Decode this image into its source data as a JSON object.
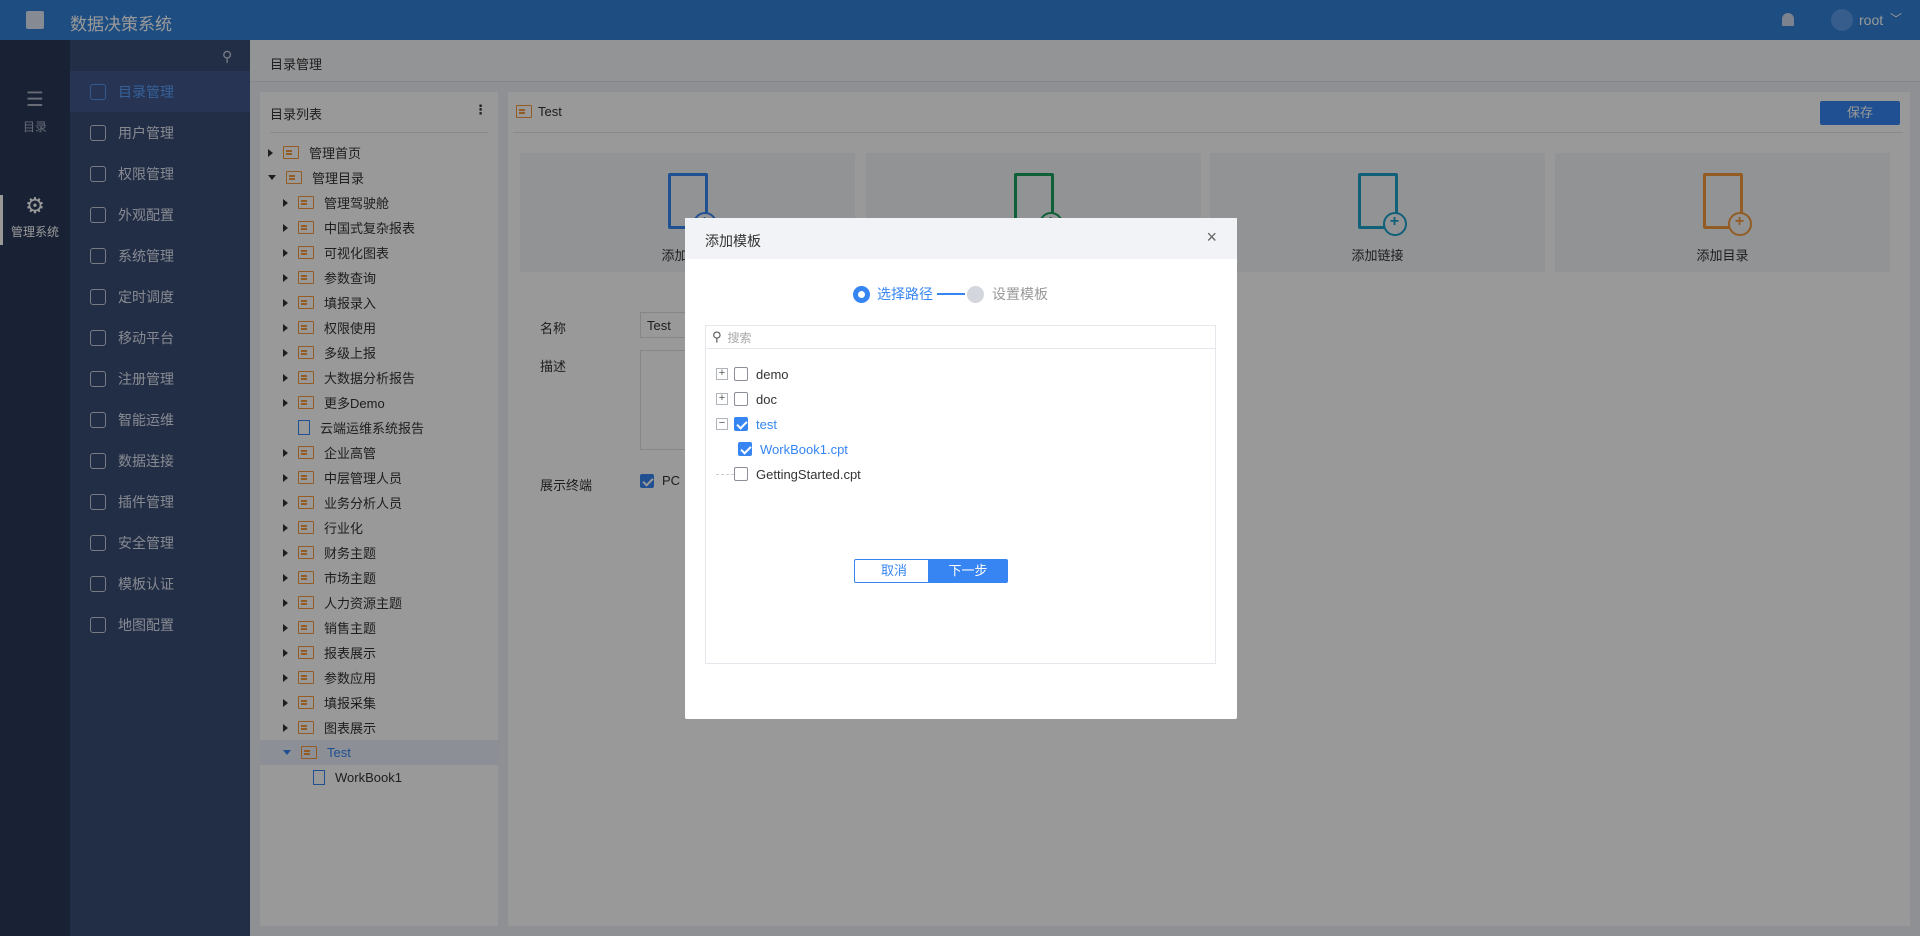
{
  "app": {
    "title": "数据决策系统",
    "user": "root",
    "icons": {
      "logo": "finereport-logo",
      "bell": "bell-icon",
      "avatar": "user-avatar-icon"
    }
  },
  "iconbar": [
    {
      "label": "目录",
      "icon": "list-icon"
    },
    {
      "label": "管理系统",
      "icon": "gear-icon",
      "active": true
    }
  ],
  "menu": [
    {
      "label": "目录管理",
      "active": true
    },
    {
      "label": "用户管理"
    },
    {
      "label": "权限管理"
    },
    {
      "label": "外观配置"
    },
    {
      "label": "系统管理"
    },
    {
      "label": "定时调度"
    },
    {
      "label": "移动平台"
    },
    {
      "label": "注册管理"
    },
    {
      "label": "智能运维"
    },
    {
      "label": "数据连接"
    },
    {
      "label": "插件管理"
    },
    {
      "label": "安全管理"
    },
    {
      "label": "模板认证"
    },
    {
      "label": "地图配置"
    }
  ],
  "breadcrumb": "目录管理",
  "tree": {
    "title": "目录列表",
    "items": [
      {
        "label": "管理首页",
        "level": 0,
        "type": "folder",
        "expanded": false
      },
      {
        "label": "管理目录",
        "level": 0,
        "type": "folder",
        "expanded": true
      },
      {
        "label": "管理驾驶舱",
        "level": 1,
        "type": "folder"
      },
      {
        "label": "中国式复杂报表",
        "level": 1,
        "type": "folder"
      },
      {
        "label": "可视化图表",
        "level": 1,
        "type": "folder"
      },
      {
        "label": "参数查询",
        "level": 1,
        "type": "folder"
      },
      {
        "label": "填报录入",
        "level": 1,
        "type": "folder"
      },
      {
        "label": "权限使用",
        "level": 1,
        "type": "folder"
      },
      {
        "label": "多级上报",
        "level": 1,
        "type": "folder"
      },
      {
        "label": "大数据分析报告",
        "level": 1,
        "type": "folder"
      },
      {
        "label": "更多Demo",
        "level": 1,
        "type": "folder"
      },
      {
        "label": "云端运维系统报告",
        "level": 1,
        "type": "file"
      },
      {
        "label": "企业高管",
        "level": 1,
        "type": "folder"
      },
      {
        "label": "中层管理人员",
        "level": 1,
        "type": "folder"
      },
      {
        "label": "业务分析人员",
        "level": 1,
        "type": "folder"
      },
      {
        "label": "行业化",
        "level": 1,
        "type": "folder"
      },
      {
        "label": "财务主题",
        "level": 1,
        "type": "folder"
      },
      {
        "label": "市场主题",
        "level": 1,
        "type": "folder"
      },
      {
        "label": "人力资源主题",
        "level": 1,
        "type": "folder"
      },
      {
        "label": "销售主题",
        "level": 1,
        "type": "folder"
      },
      {
        "label": "报表展示",
        "level": 1,
        "type": "folder"
      },
      {
        "label": "参数应用",
        "level": 1,
        "type": "folder"
      },
      {
        "label": "填报采集",
        "level": 1,
        "type": "folder"
      },
      {
        "label": "图表展示",
        "level": 1,
        "type": "folder"
      },
      {
        "label": "Test",
        "level": 1,
        "type": "folder",
        "expanded": true,
        "selected": true
      },
      {
        "label": "WorkBook1",
        "level": 2,
        "type": "file"
      }
    ]
  },
  "detail": {
    "title": "Test",
    "save": "保存",
    "cards": [
      {
        "label": "添加模板",
        "color": "#3685f2"
      },
      {
        "label": "",
        "color": "#1aa05f"
      },
      {
        "label": "添加链接",
        "color": "#1aa0c8"
      },
      {
        "label": "添加目录",
        "color": "#f39a3d"
      }
    ],
    "form": {
      "name_label": "名称",
      "name_value": "Test",
      "desc_label": "描述",
      "desc_value": "",
      "terminal_label": "展示终端",
      "pc_label": "PC",
      "pc_checked": true
    }
  },
  "dialog": {
    "title": "添加模板",
    "steps": [
      {
        "label": "选择路径",
        "active": true
      },
      {
        "label": "设置模板",
        "active": false
      }
    ],
    "search_placeholder": "搜索",
    "items": [
      {
        "label": "demo",
        "checked": false,
        "expander": "+",
        "level": 0
      },
      {
        "label": "doc",
        "checked": false,
        "expander": "+",
        "level": 0
      },
      {
        "label": "test",
        "checked": true,
        "expander": "−",
        "level": 0
      },
      {
        "label": "WorkBook1.cpt",
        "checked": true,
        "level": 1
      },
      {
        "label": "GettingStarted.cpt",
        "checked": false,
        "level": 0
      }
    ],
    "cancel": "取消",
    "next": "下一步"
  },
  "colors": {
    "accent": "#3685f2",
    "topbar": "#3380d8"
  }
}
